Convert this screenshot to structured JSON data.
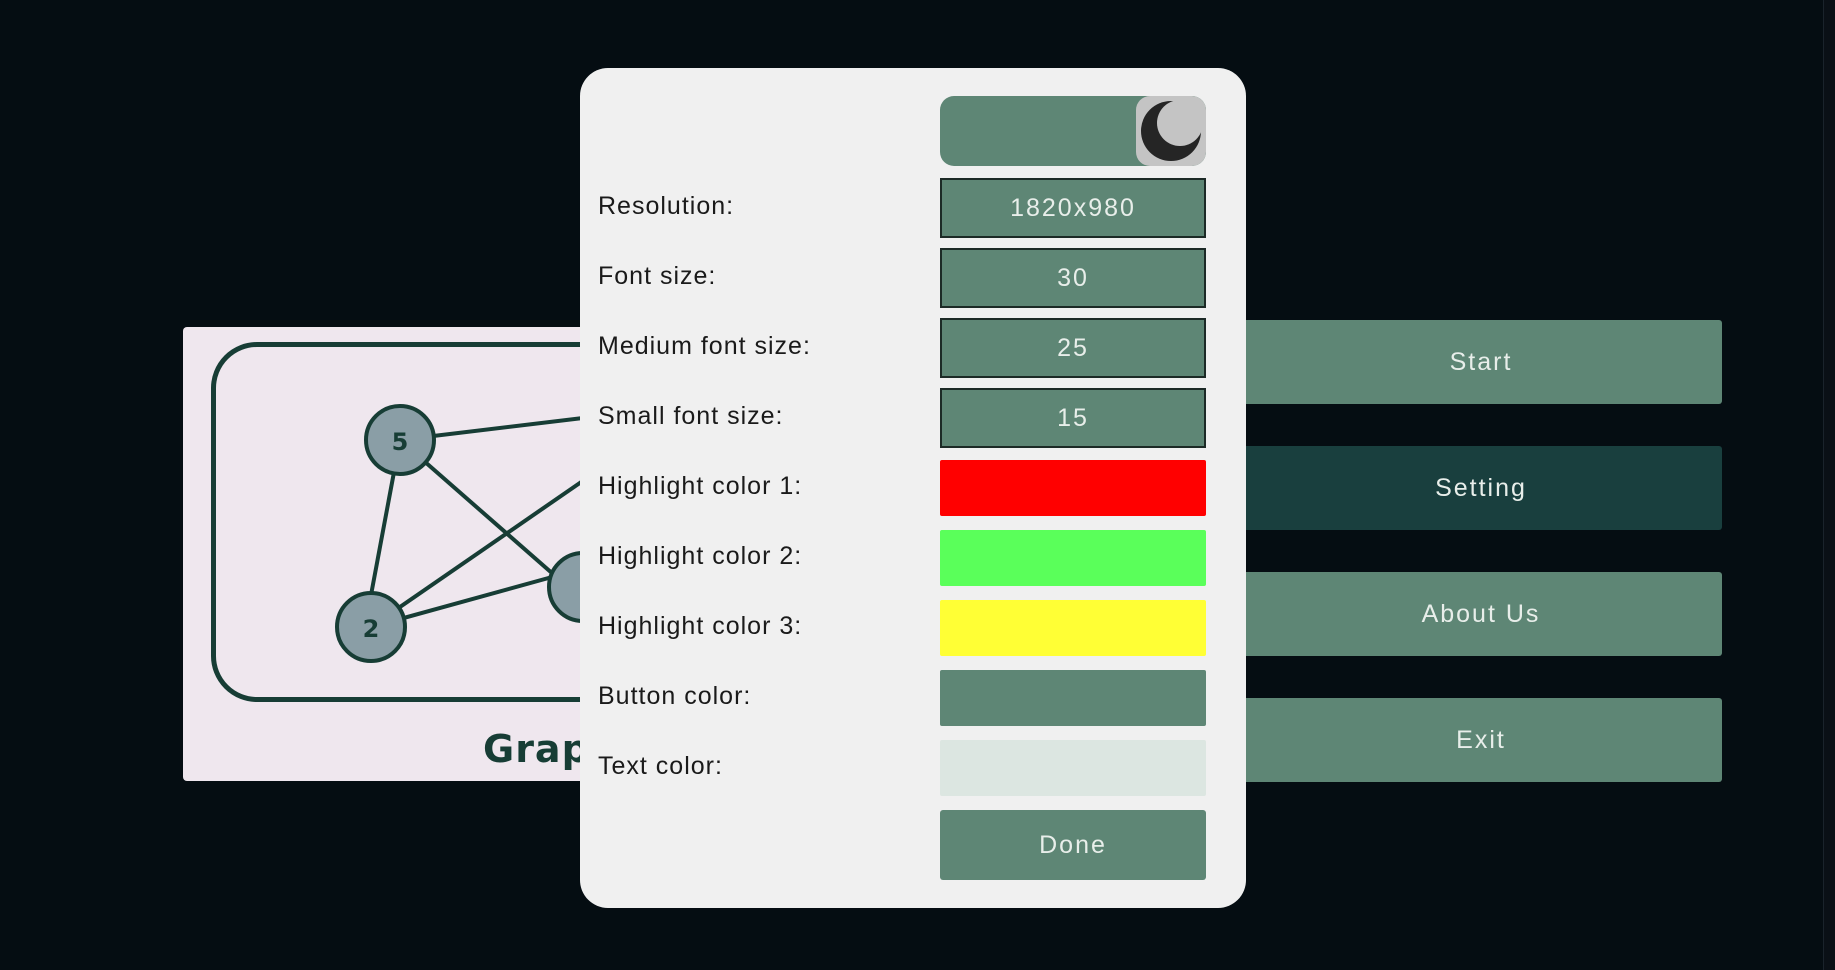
{
  "logo": {
    "title": "Grap",
    "nodes": [
      "5",
      "2"
    ]
  },
  "menu": {
    "buttons": [
      {
        "label": "Start"
      },
      {
        "label": "Setting"
      },
      {
        "label": "About Us"
      },
      {
        "label": "Exit"
      }
    ]
  },
  "settings": {
    "theme_toggle_icon": "moon-icon",
    "resolution_label": "Resolution:",
    "resolution_value": "1820x980",
    "font_size_label": "Font size:",
    "font_size_value": "30",
    "medium_font_size_label": "Medium font size:",
    "medium_font_size_value": "25",
    "small_font_size_label": "Small font size:",
    "small_font_size_value": "15",
    "highlight_color_1_label": "Highlight color 1:",
    "highlight_color_1": "#ff0000",
    "highlight_color_2_label": "Highlight color 2:",
    "highlight_color_2": "#5aff5a",
    "highlight_color_3_label": "Highlight color 3:",
    "highlight_color_3": "#ffff35",
    "button_color_label": "Button color:",
    "button_color": "#5e8675",
    "text_color_label": "Text color:",
    "text_color": "#dce6e1",
    "done_label": "Done"
  },
  "colors": {
    "background": "#050d12",
    "button": "#5e8675",
    "button_active": "#193f3e",
    "dialog": "#f0f0f0"
  }
}
